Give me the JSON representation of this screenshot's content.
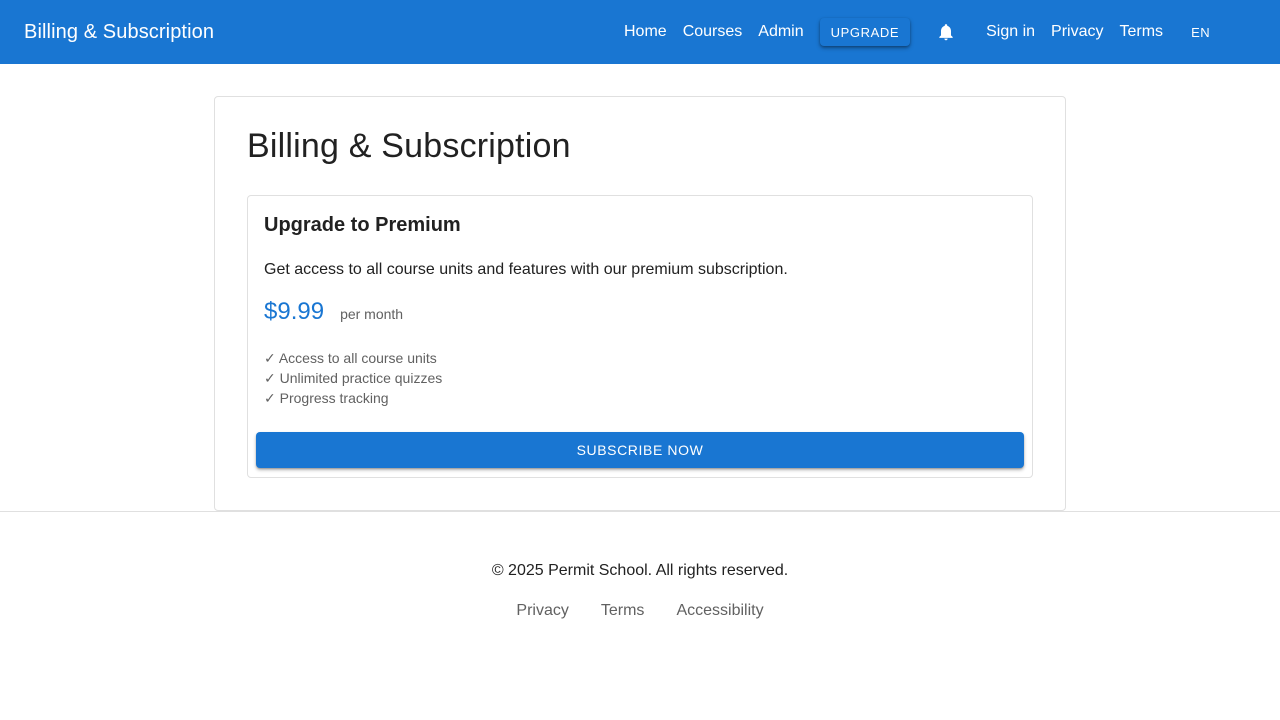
{
  "colors": {
    "primary": "#1976d2",
    "text": "#212121",
    "text_secondary": "#616161",
    "border": "#e0e0e0"
  },
  "appbar": {
    "title": "Billing & Subscription",
    "nav": {
      "home": "Home",
      "courses": "Courses",
      "admin": "Admin",
      "upgrade": "UPGRADE",
      "notifications_icon": "bell-icon",
      "sign_in": "Sign in",
      "privacy": "Privacy",
      "terms": "Terms",
      "language": "EN"
    }
  },
  "main": {
    "title": "Billing & Subscription",
    "plan": {
      "title": "Upgrade to Premium",
      "description": "Get access to all course units and features with our premium subscription.",
      "price": "$9.99",
      "period": "per month",
      "features": [
        "✓ Access to all course units",
        "✓ Unlimited practice quizzes",
        "✓ Progress tracking"
      ],
      "subscribe_label": "SUBSCRIBE NOW"
    }
  },
  "footer": {
    "copyright": "© 2025 Permit School. All rights reserved.",
    "links": {
      "privacy": "Privacy",
      "terms": "Terms",
      "accessibility": "Accessibility"
    }
  }
}
